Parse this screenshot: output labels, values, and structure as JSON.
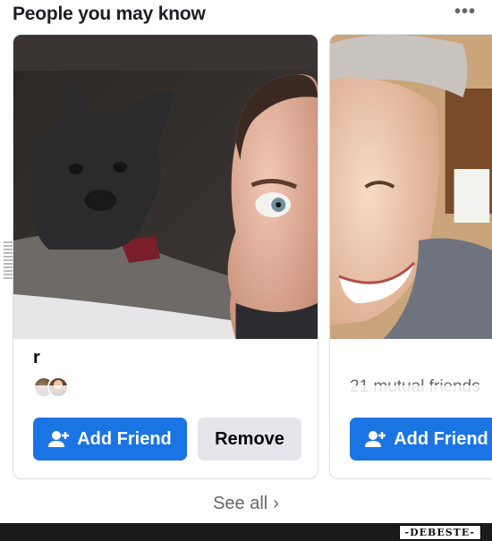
{
  "header": {
    "title": "People you may know",
    "more_label": "•••"
  },
  "cards": [
    {
      "name": "r",
      "mutual": "",
      "add_label": "Add Friend",
      "remove_label": "Remove"
    },
    {
      "mutual": "21 mutual friends",
      "add_label": "Add Friend"
    }
  ],
  "footer": {
    "see_all_label": "See all",
    "chevron": "›"
  },
  "watermark": "-DEBESTE-",
  "icons": {
    "add_friend": "person-plus-icon",
    "more": "ellipsis-icon",
    "chevron": "chevron-right-icon"
  },
  "colors": {
    "primary_button": "#1b74e4",
    "secondary_button": "#e4e6eb",
    "muted_text": "#65676b"
  }
}
